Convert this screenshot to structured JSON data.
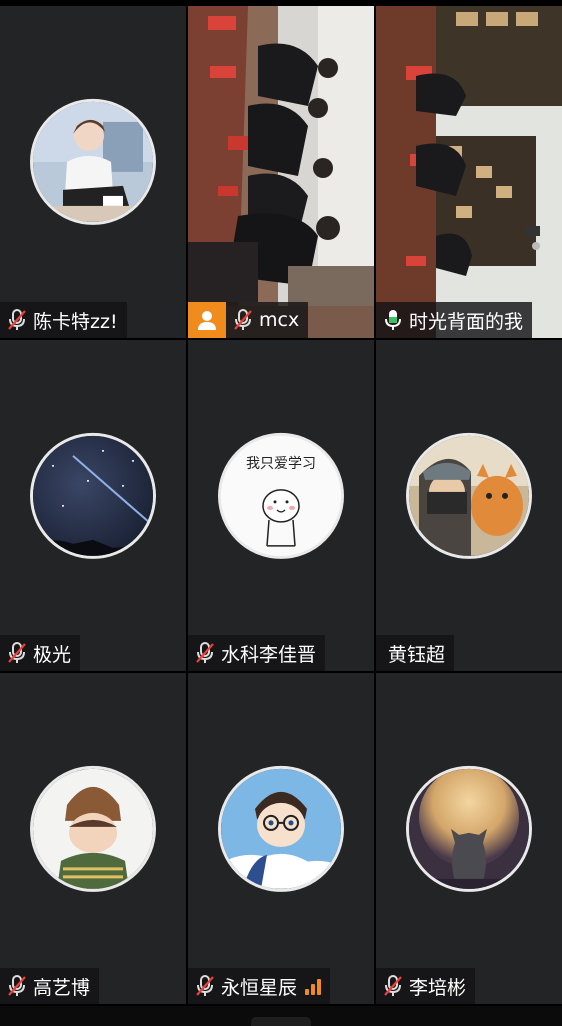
{
  "participants": [
    {
      "name": "陈卡特zz!",
      "mic": "muted",
      "type": "avatar",
      "avatar": "boy-sitting-avatar"
    },
    {
      "name": "mcx",
      "mic": "muted",
      "type": "video",
      "host": true,
      "avatar": "meeting-room-video"
    },
    {
      "name": "时光背面的我",
      "mic": "active",
      "type": "video",
      "active_speaker": true,
      "avatar": "meeting-room-video-2"
    },
    {
      "name": "极光",
      "mic": "muted",
      "type": "avatar",
      "avatar": "night-sky-avatar"
    },
    {
      "name": "水科李佳晋",
      "mic": "muted",
      "type": "avatar",
      "avatar": "cartoon-study-avatar",
      "avatar_text": "我只爱学习"
    },
    {
      "name": "黄钰超",
      "mic": "none",
      "type": "avatar",
      "avatar": "ninja-cat-avatar"
    },
    {
      "name": "高艺博",
      "mic": "muted",
      "type": "avatar",
      "avatar": "child-beanie-avatar"
    },
    {
      "name": "永恒星辰",
      "mic": "muted",
      "type": "avatar",
      "avatar": "anime-boy-avatar",
      "signal": "weak"
    },
    {
      "name": "李培彬",
      "mic": "muted",
      "type": "avatar",
      "avatar": "cat-moon-avatar"
    }
  ],
  "colors": {
    "tile_bg": "#232426",
    "active_border": "#3cc26a",
    "host_badge": "#f08c1e",
    "muted_icon": "#e9413a",
    "active_mic": "#3cc26a"
  }
}
